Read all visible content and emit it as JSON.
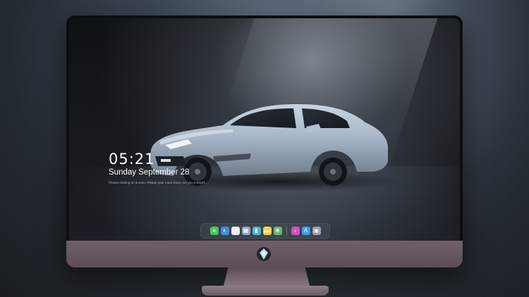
{
  "lockscreen": {
    "time": "05:21",
    "date": "Sunday September  28",
    "message": "Please clicking on screen. Please your more lively. Are you a Bright ..."
  },
  "dock": {
    "apps": [
      {
        "name": "messages",
        "icon": "messages-icon",
        "color": "#3ecf5a",
        "glyph": "●"
      },
      {
        "name": "finder",
        "icon": "finder-icon",
        "color": "#3a8ee8",
        "glyph": "◐"
      },
      {
        "name": "safari",
        "icon": "safari-icon",
        "color": "#e8eaee",
        "glyph": "◎"
      },
      {
        "name": "preview",
        "icon": "preview-icon",
        "color": "#8fa9c4",
        "glyph": "▦"
      },
      {
        "name": "final-cut",
        "icon": "film-icon",
        "color": "#48b8d8",
        "glyph": "▮"
      },
      {
        "name": "notes",
        "icon": "notes-icon",
        "color": "#f5d547",
        "glyph": "▬"
      },
      {
        "name": "photos",
        "icon": "photos-icon",
        "color": "#68b86a",
        "glyph": "❀"
      },
      {
        "name": "itunes",
        "icon": "music-icon",
        "color": "#d64bc8",
        "glyph": "♪"
      },
      {
        "name": "app-store",
        "icon": "app-store-icon",
        "color": "#3b9cf0",
        "glyph": "A"
      },
      {
        "name": "camera",
        "icon": "camera-icon",
        "color": "#9aa3ad",
        "glyph": "◉"
      }
    ]
  },
  "colors": {
    "car_body": "#a9b8c8",
    "chin": "#6f5f68"
  }
}
